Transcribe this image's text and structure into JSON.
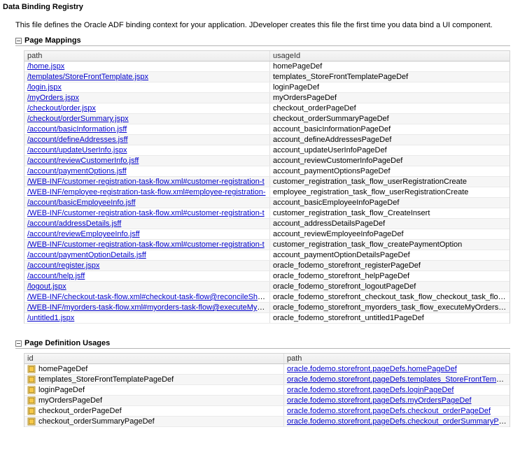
{
  "title": "Data Binding Registry",
  "intro": "This file defines the Oracle ADF binding context for your application. JDeveloper creates this file the first time you data bind a UI component.",
  "sections": {
    "mappings": {
      "heading": "Page Mappings",
      "cols": {
        "path": "path",
        "usageId": "usageId"
      },
      "rows": [
        {
          "path": "/home.jspx",
          "usageId": "homePageDef"
        },
        {
          "path": "/templates/StoreFrontTemplate.jspx",
          "usageId": "templates_StoreFrontTemplatePageDef"
        },
        {
          "path": "/login.jspx",
          "usageId": "loginPageDef"
        },
        {
          "path": "/myOrders.jspx",
          "usageId": "myOrdersPageDef"
        },
        {
          "path": "/checkout/order.jspx",
          "usageId": "checkout_orderPageDef"
        },
        {
          "path": "/checkout/orderSummary.jspx",
          "usageId": "checkout_orderSummaryPageDef"
        },
        {
          "path": "/account/basicInformation.jsff",
          "usageId": "account_basicInformationPageDef"
        },
        {
          "path": "/account/defineAddresses.jsff",
          "usageId": "account_defineAddressesPageDef"
        },
        {
          "path": "/account/updateUserInfo.jspx",
          "usageId": "account_updateUserInfoPageDef"
        },
        {
          "path": "/account/reviewCustomerInfo.jsff",
          "usageId": "account_reviewCustomerInfoPageDef"
        },
        {
          "path": "/account/paymentOptions.jsff",
          "usageId": "account_paymentOptionsPageDef"
        },
        {
          "path": "/WEB-INF/customer-registration-task-flow.xml#customer-registration-t",
          "usageId": "customer_registration_task_flow_userRegistrationCreate"
        },
        {
          "path": "/WEB-INF/employee-registration-task-flow.xml#employee-registration-",
          "usageId": "employee_registration_task_flow_userRegistrationCreate"
        },
        {
          "path": "/account/basicEmployeeInfo.jsff",
          "usageId": "account_basicEmployeeInfoPageDef"
        },
        {
          "path": "/WEB-INF/customer-registration-task-flow.xml#customer-registration-t",
          "usageId": "customer_registration_task_flow_CreateInsert"
        },
        {
          "path": "/account/addressDetails.jsff",
          "usageId": "account_addressDetailsPageDef"
        },
        {
          "path": "/account/reviewEmployeeInfo.jsff",
          "usageId": "account_reviewEmployeeInfoPageDef"
        },
        {
          "path": "/WEB-INF/customer-registration-task-flow.xml#customer-registration-t",
          "usageId": "customer_registration_task_flow_createPaymentOption"
        },
        {
          "path": "/account/paymentOptionDetails.jsff",
          "usageId": "account_paymentOptionDetailsPageDef"
        },
        {
          "path": "/account/register.jspx",
          "usageId": "oracle_fodemo_storefront_registerPageDef"
        },
        {
          "path": "/account/help.jsff",
          "usageId": "oracle_fodemo_storefront_helpPageDef"
        },
        {
          "path": "/logout.jspx",
          "usageId": "oracle_fodemo_storefront_logoutPageDef"
        },
        {
          "path": "/WEB-INF/checkout-task-flow.xml#checkout-task-flow@reconcileShopp",
          "usageId": "oracle_fodemo_storefront_checkout_task_flow_checkout_task_flow..."
        },
        {
          "path": "/WEB-INF/myorders-task-flow.xml#myorders-task-flow@executeMyOrd",
          "usageId": "oracle_fodemo_storefront_myorders_task_flow_executeMyOrdersF..."
        },
        {
          "path": "/untitled1.jspx",
          "usageId": "oracle_fodemo_storefront_untitled1PageDef"
        }
      ]
    },
    "usages": {
      "heading": "Page Definition Usages",
      "cols": {
        "id": "id",
        "path": "path"
      },
      "rows": [
        {
          "id": "homePageDef",
          "path": "oracle.fodemo.storefront.pageDefs.homePageDef"
        },
        {
          "id": "templates_StoreFrontTemplatePageDef",
          "path": "oracle.fodemo.storefront.pageDefs.templates_StoreFrontTemplatePag"
        },
        {
          "id": "loginPageDef",
          "path": "oracle.fodemo.storefront.pageDefs.loginPageDef"
        },
        {
          "id": "myOrdersPageDef",
          "path": "oracle.fodemo.storefront.pageDefs.myOrdersPageDef"
        },
        {
          "id": "checkout_orderPageDef",
          "path": "oracle.fodemo.storefront.pageDefs.checkout_orderPageDef"
        },
        {
          "id": "checkout_orderSummaryPageDef",
          "path": "oracle.fodemo.storefront.pageDefs.checkout_orderSummaryPageDef"
        }
      ]
    }
  }
}
